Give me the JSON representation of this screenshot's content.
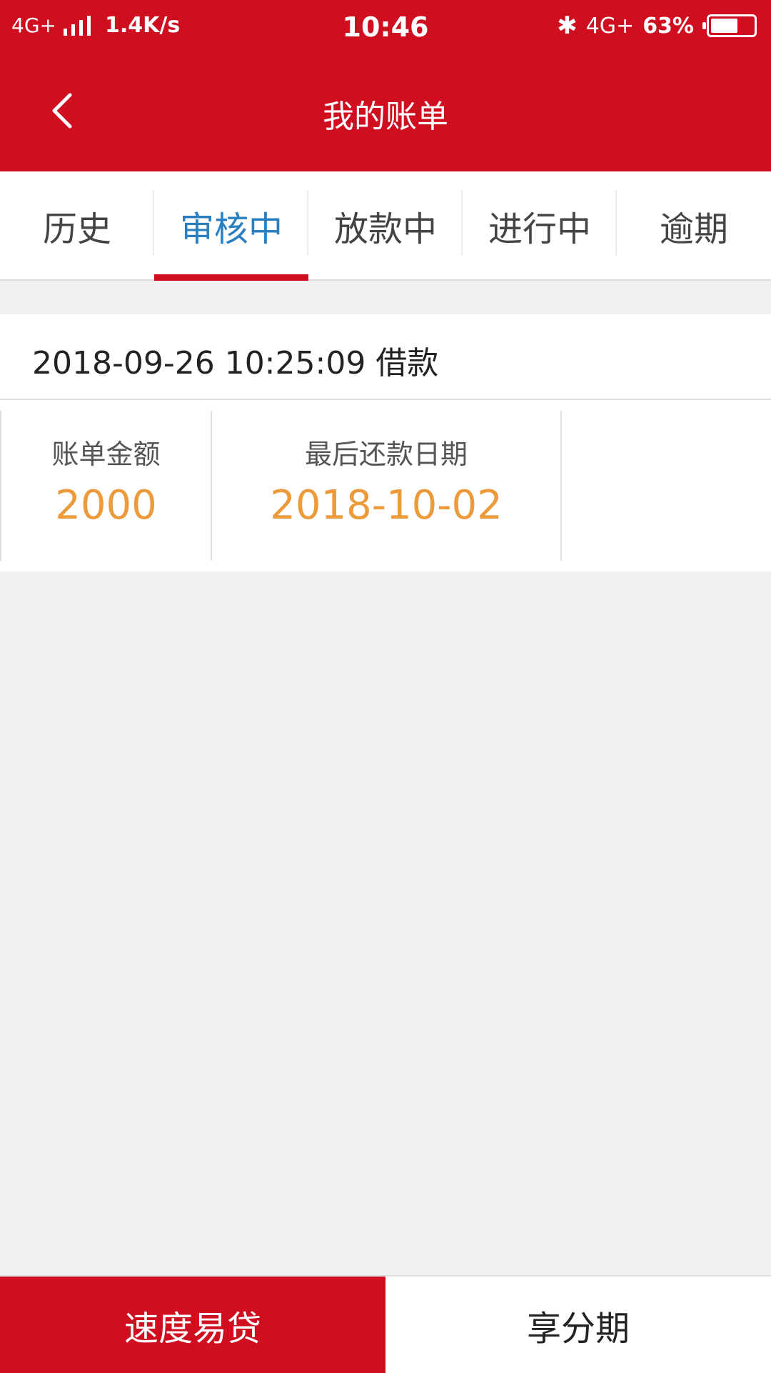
{
  "status_bar": {
    "network_left": "4G+",
    "speed": "1.4K/s",
    "time": "10:46",
    "network_right": "4G+",
    "battery_percent": "63%",
    "battery_level": 0.63,
    "signal_icon": "signal-bars-icon",
    "bluetooth_icon": "bluetooth-icon",
    "battery_icon": "battery-icon"
  },
  "header": {
    "title": "我的账单",
    "back_icon": "chevron-left-icon",
    "background_color": "#cf0e1f"
  },
  "tabs": [
    {
      "label": "历史",
      "active": false
    },
    {
      "label": "审核中",
      "active": true
    },
    {
      "label": "放款中",
      "active": false
    },
    {
      "label": "进行中",
      "active": false
    },
    {
      "label": "逾期",
      "active": false
    }
  ],
  "bill": {
    "header_text": "2018-09-26 10:25:09 借款",
    "amount_label": "账单金额",
    "amount_value": "2000",
    "due_label": "最后还款日期",
    "due_value": "2018-10-02"
  },
  "bottom_bar": {
    "primary_label": "速度易贷",
    "secondary_label": "享分期"
  },
  "colors": {
    "brand_red": "#cf0e1f",
    "active_tab_blue": "#2a7fc1",
    "value_orange": "#ec9a3a"
  }
}
